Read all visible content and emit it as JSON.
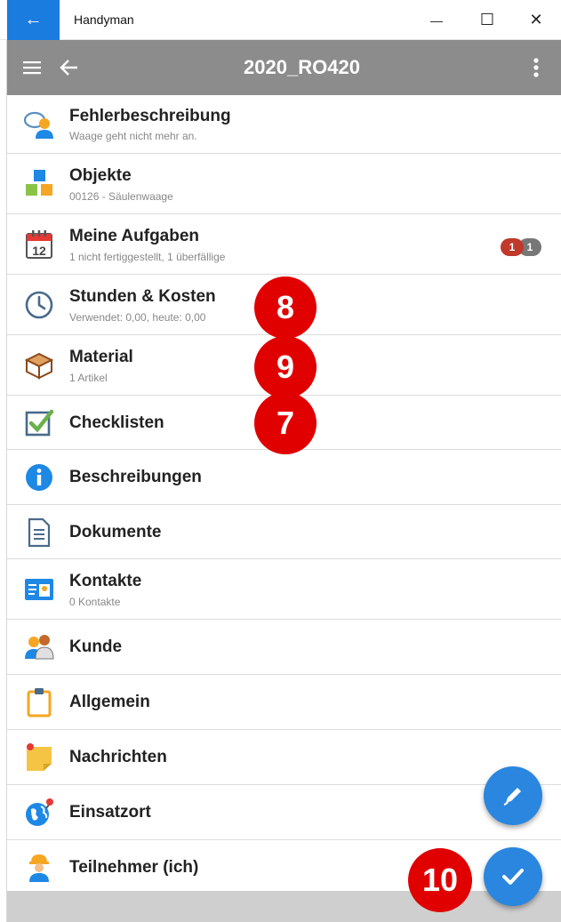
{
  "window": {
    "title": "Handyman",
    "back_glyph": "←",
    "minimize_glyph": "—",
    "maximize_glyph": "☐",
    "close_glyph": "✕"
  },
  "toolbar": {
    "title": "2020_RO420",
    "menu_icon": "hamburger-icon",
    "back_icon": "arrow-left-icon",
    "more_icon": "more-vertical-icon"
  },
  "items": [
    {
      "label": "Fehlerbeschreibung",
      "sub": "Waage geht nicht mehr an.",
      "icon": "chat-person-icon"
    },
    {
      "label": "Objekte",
      "sub": "00126 - Säulenwaage",
      "icon": "cubes-icon"
    },
    {
      "label": "Meine Aufgaben",
      "sub": "1 nicht fertiggestellt, 1 überfällige",
      "icon": "calendar-icon"
    },
    {
      "label": "Stunden & Kosten",
      "sub": "Verwendet: 0,00, heute: 0,00",
      "icon": "clock-icon"
    },
    {
      "label": "Material",
      "sub": "1 Artikel",
      "icon": "box-icon"
    },
    {
      "label": "Checklisten",
      "icon": "checkbox-icon"
    },
    {
      "label": "Beschreibungen",
      "icon": "info-icon"
    },
    {
      "label": "Dokumente",
      "icon": "document-icon"
    },
    {
      "label": "Kontakte",
      "sub": "0 Kontakte",
      "icon": "contact-card-icon"
    },
    {
      "label": "Kunde",
      "icon": "customer-icon"
    },
    {
      "label": "Allgemein",
      "icon": "clipboard-icon"
    },
    {
      "label": "Nachrichten",
      "icon": "sticky-note-icon"
    },
    {
      "label": "Einsatzort",
      "icon": "globe-pin-icon"
    },
    {
      "label": "Teilnehmer (ich)",
      "icon": "worker-icon"
    }
  ],
  "task_badges": [
    "1",
    "1"
  ],
  "colors": {
    "accent": "#2a86de",
    "toolbar": "#8c8c8c",
    "titlebar_back": "#1b7ce0",
    "badge_red": "#c0392b",
    "badge_gray": "#777777",
    "callout_red": "#e00000"
  },
  "callouts": [
    "8",
    "9",
    "7",
    "10"
  ],
  "fabs": {
    "edit_icon": "pen-icon",
    "confirm_icon": "check-icon"
  }
}
